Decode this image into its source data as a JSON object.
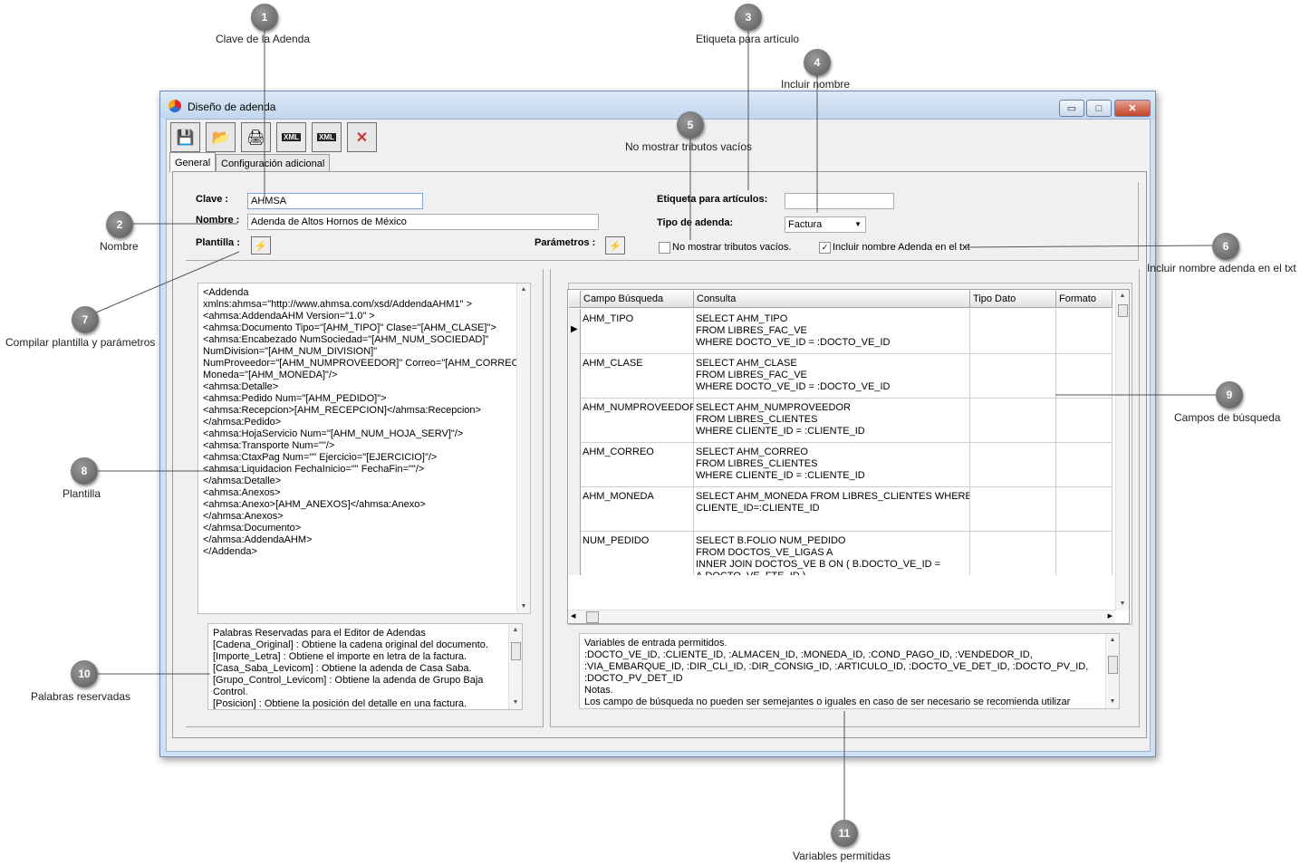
{
  "callouts": [
    {
      "n": "1",
      "label": "Clave de la Adenda"
    },
    {
      "n": "2",
      "label": "Nombre"
    },
    {
      "n": "3",
      "label": "Etiqueta para artículo"
    },
    {
      "n": "4",
      "label": "Incluir nombre"
    },
    {
      "n": "5",
      "label": "No mostrar tributos vacíos"
    },
    {
      "n": "6",
      "label": "Incluir nombre adenda  en el txt"
    },
    {
      "n": "7",
      "label": "Compilar plantilla y  parámetros"
    },
    {
      "n": "8",
      "label": "Plantilla"
    },
    {
      "n": "9",
      "label": "Campos de búsqueda"
    },
    {
      "n": "10",
      "label": "Palabras reservadas"
    },
    {
      "n": "11",
      "label": "Variables permitidas"
    }
  ],
  "window": {
    "title": "Diseño de adenda",
    "min": "▭",
    "max": "□",
    "close": "✕"
  },
  "tabs": {
    "general": "General",
    "config": "Configuración adicional"
  },
  "form": {
    "clave_label": "Clave :",
    "clave_value": "AHMSA",
    "nombre_label": "Nombre :",
    "nombre_value": "Adenda de Altos Hornos de México",
    "plantilla_label": "Plantilla :",
    "parametros_label": "Parámetros :",
    "etiqueta_label": "Etiqueta para artículos:",
    "etiqueta_value": "",
    "tipo_label": "Tipo de adenda:",
    "tipo_value": "Factura",
    "no_mostrar_label": "No mostrar tributos vacíos.",
    "no_mostrar_checked": false,
    "incluir_label": "Incluir nombre Adenda  en el txt",
    "incluir_checked": true,
    "incluir_mark": "✓"
  },
  "template_lines": [
    "<Addenda",
    "xmlns:ahmsa=\"http://www.ahmsa.com/xsd/AddendaAHM1\" >",
    "<ahmsa:AddendaAHM Version=\"1.0\" >",
    "<ahmsa:Documento Tipo=\"[AHM_TIPO]\" Clase=\"[AHM_CLASE]\">",
    "<ahmsa:Encabezado NumSociedad=\"[AHM_NUM_SOCIEDAD]\"",
    "NumDivision=\"[AHM_NUM_DIVISION]\"",
    "NumProveedor=\"[AHM_NUMPROVEEDOR]\" Correo=\"[AHM_CORREO]\"",
    "Moneda=\"[AHM_MONEDA]\"/>",
    "<ahmsa:Detalle>",
    "<ahmsa:Pedido Num=\"[AHM_PEDIDO]\">",
    "<ahmsa:Recepcion>[AHM_RECEPCION]</ahmsa:Recepcion>",
    "</ahmsa:Pedido>",
    "<ahmsa:HojaServicio Num=\"[AHM_NUM_HOJA_SERV]\"/>",
    "<ahmsa:Transporte Num=\"\"/>",
    "<ahmsa:CtaxPag Num=\"\" Ejercicio=\"[EJERCICIO]\"/>",
    "<ahmsa:Liquidacion FechaInicio=\"\" FechaFin=\"\"/>",
    "</ahmsa:Detalle>",
    "<ahmsa:Anexos>",
    "<ahmsa:Anexo>[AHM_ANEXOS]</ahmsa:Anexo>",
    "</ahmsa:Anexos>",
    "</ahmsa:Documento>",
    "</ahmsa:AddendaAHM>",
    "</Addenda>"
  ],
  "reserved_lines": [
    "Palabras Reservadas para el Editor de Adendas",
    "    [Cadena_Original] : Obtiene la cadena original del documento.",
    "   [Importe_Letra] : Obtiene el importe en letra de la factura.",
    "   [Casa_Saba_Levicom] : Obtiene la adenda de Casa Saba.",
    "   [Grupo_Control_Levicom] : Obtiene la adenda de Grupo Baja",
    "Control.",
    "   [Posicion] : Obtiene la posición del detalle en una factura."
  ],
  "grid": {
    "headers": [
      "Campo Búsqueda",
      "Consulta",
      "Tipo Dato",
      "Formato"
    ],
    "rows": [
      {
        "campo": "AHM_TIPO",
        "consulta": "SELECT AHM_TIPO\nFROM LIBRES_FAC_VE\nWHERE DOCTO_VE_ID = :DOCTO_VE_ID"
      },
      {
        "campo": "AHM_CLASE",
        "consulta": "SELECT AHM_CLASE\nFROM LIBRES_FAC_VE\nWHERE DOCTO_VE_ID = :DOCTO_VE_ID"
      },
      {
        "campo": "AHM_NUMPROVEEDOR",
        "consulta": "SELECT AHM_NUMPROVEEDOR\nFROM LIBRES_CLIENTES\nWHERE CLIENTE_ID = :CLIENTE_ID"
      },
      {
        "campo": "AHM_CORREO",
        "consulta": "SELECT AHM_CORREO\nFROM LIBRES_CLIENTES\nWHERE CLIENTE_ID = :CLIENTE_ID"
      },
      {
        "campo": "AHM_MONEDA",
        "consulta": "SELECT AHM_MONEDA FROM LIBRES_CLIENTES WHERE\nCLIENTE_ID=:CLIENTE_ID"
      },
      {
        "campo": "NUM_PEDIDO",
        "consulta": "SELECT B.FOLIO NUM_PEDIDO\nFROM DOCTOS_VE_LIGAS A\nINNER JOIN DOCTOS_VE B ON ( B.DOCTO_VE_ID =\nA.DOCTO_VE_FTE_ID )"
      }
    ]
  },
  "variables_lines": [
    "Variables de entrada permitidos.",
    ":DOCTO_VE_ID, :CLIENTE_ID, :ALMACEN_ID, :MONEDA_ID, :COND_PAGO_ID, :VENDEDOR_ID,",
    ":VIA_EMBARQUE_ID, :DIR_CLI_ID, :DIR_CONSIG_ID, :ARTICULO_ID, :DOCTO_VE_DET_ID, :DOCTO_PV_ID,",
    ":DOCTO_PV_DET_ID",
    "Notas.",
    "Los campo de búsqueda no pueden ser semejantes o iguales en caso de ser necesario se recomienda utilizar"
  ]
}
